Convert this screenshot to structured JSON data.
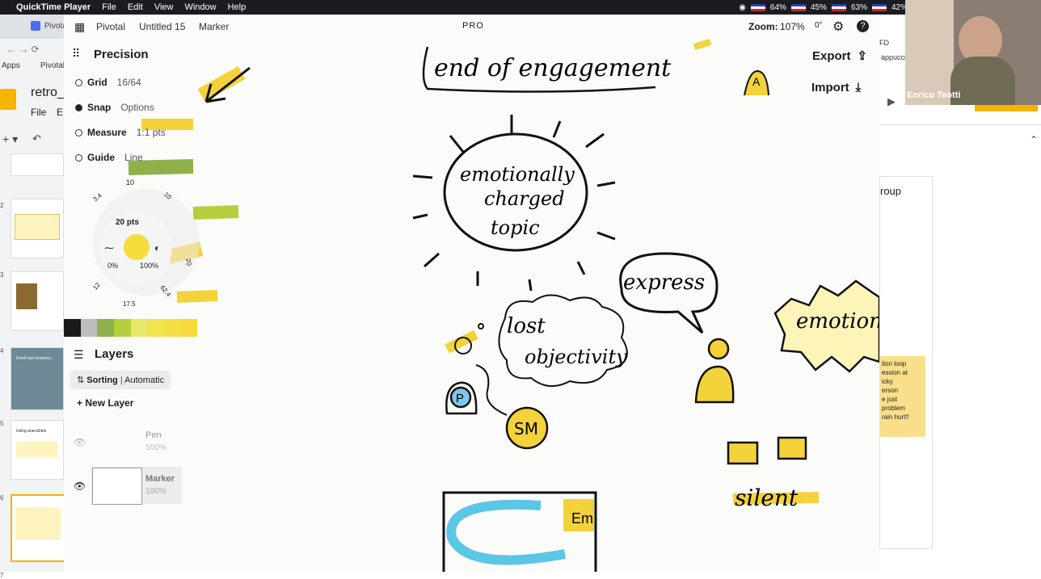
{
  "menubar": {
    "app_name": "QuickTime Player",
    "menus": [
      "File",
      "Edit",
      "View",
      "Window",
      "Help"
    ],
    "status": {
      "cpu": "64%",
      "ram": "45%",
      "disk": "63%",
      "battery": "42%"
    }
  },
  "browser": {
    "tab_label": "Pivota",
    "bookmarks": {
      "apps": "Apps",
      "pivotal": "Pivotal"
    },
    "doc_title": "retro_",
    "doc_menu": {
      "file": "File",
      "edit": "E"
    },
    "slides": [
      "2",
      "3",
      "4",
      "5",
      "6",
      "7"
    ],
    "slide_texts": {
      "slide4": "Fresh last sessions...",
      "slide5": "Using anecdotes"
    },
    "right_panel": {
      "label_group": "roup",
      "sticky_lines": [
        "tion loop",
        "ession at",
        "icky",
        "",
        "erson",
        "e just",
        "problem",
        "rain hurt!!"
      ],
      "tappuccino": "appuccino",
      "fd": "FD"
    }
  },
  "video": {
    "name": "Enrico Teotti"
  },
  "concepts": {
    "breadcrumb": {
      "home": "Pivotal",
      "drawing": "Untitled 15",
      "tool": "Marker"
    },
    "pro": "PRO",
    "zoom_label": "Zoom:",
    "zoom_value": "107%",
    "rotation": "0°",
    "export": "Export",
    "import": "Import",
    "precision": {
      "title": "Precision",
      "grid": "Grid",
      "grid_value": "16/64",
      "snap": "Snap",
      "snap_value": "Options",
      "measure": "Measure",
      "measure_value": "1:1 pts",
      "guide": "Guide",
      "guide_value": "Line"
    },
    "brush": {
      "size": "20 pts",
      "opacity_min": "0%",
      "opacity_max": "100%",
      "presets": [
        "10",
        "3.4",
        "10",
        "20",
        "62.4",
        "17.5",
        "12"
      ]
    },
    "palette": [
      "#1a1a1a",
      "#bdbdbd",
      "#8fb04a",
      "#b6cf3f",
      "#e9e76a",
      "#f1e44f",
      "#f5de46",
      "#f7d93a"
    ],
    "layers": {
      "title": "Layers",
      "sorting": "Sorting",
      "sorting_mode": "Automatic",
      "new_layer": "New Layer",
      "items": [
        {
          "name": "Pen",
          "opacity": "100%"
        },
        {
          "name": "Marker",
          "opacity": "100%"
        }
      ]
    },
    "drawing": {
      "heading": "end of engagement",
      "bubble_main": [
        "emotionally",
        "charged",
        "topic"
      ],
      "bubble_express": "express",
      "cloud": [
        "lost",
        "objectivity"
      ],
      "emotion": "emotion",
      "silent": "silent",
      "sm": "SM",
      "p": "P",
      "a": "A",
      "em": "Em"
    }
  }
}
